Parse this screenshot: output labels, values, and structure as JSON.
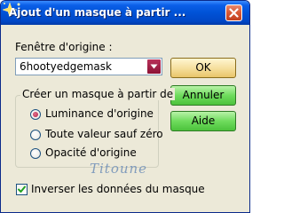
{
  "window": {
    "title": "Ajout d'un masque à partir ...",
    "close_icon": "close-icon"
  },
  "source": {
    "label": "Fenêtre d'origine :",
    "selected": "6hootyedgemask"
  },
  "buttons": {
    "ok": "OK",
    "cancel": "Annuler",
    "help": "Aide"
  },
  "create_group": {
    "title": "Créer un masque à partir de",
    "options": [
      {
        "label": "Luminance d'origine",
        "selected": true
      },
      {
        "label": "Toute valeur sauf zéro",
        "selected": false
      },
      {
        "label": "Opacité d'origine",
        "selected": false
      }
    ]
  },
  "invert": {
    "label": "Inverser les données du masque",
    "checked": true
  },
  "watermark": "Titoune",
  "colors": {
    "titlebar": "#0052d6",
    "ok_button": "#f6e0a0",
    "green_button": "#6fdc5d",
    "close_button": "#d95a36"
  }
}
